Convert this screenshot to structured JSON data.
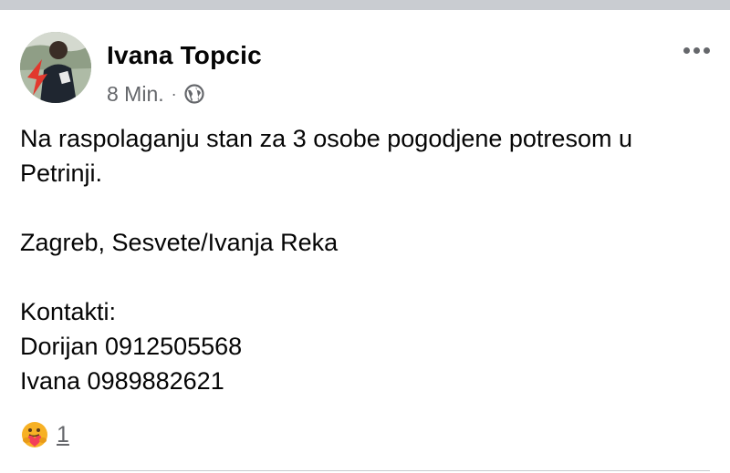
{
  "post": {
    "author": "Ivana Topcic",
    "time": "8 Min.",
    "separator": "·",
    "audience_icon": "globe-icon",
    "more_icon": "more-horizontal-icon",
    "paragraphs": [
      "Na raspolaganju stan za 3 osobe pogodjene potresom u Petrinji.",
      "Zagreb, Sesvete/Ivanja Reka",
      "Kontakti:\nDorijan 0912505568\nIvana 0989882621"
    ],
    "reactions": {
      "icon": "care-reaction-icon",
      "count": "1"
    }
  },
  "colors": {
    "text": "#050505",
    "secondary_text": "#65676b",
    "top_strip": "#c9ccd1",
    "care_face": "#f7b125",
    "care_heart": "#f33e58"
  }
}
